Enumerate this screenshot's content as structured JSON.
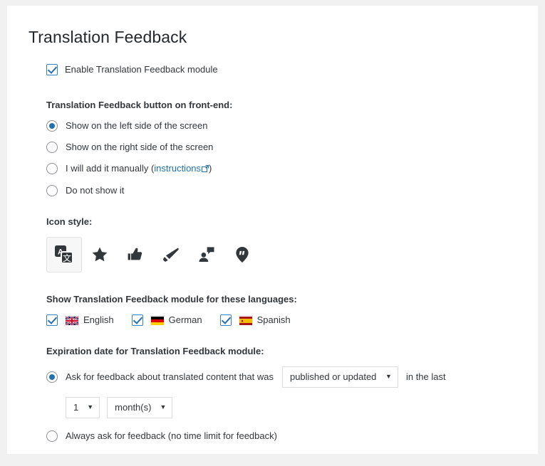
{
  "page": {
    "title": "Translation Feedback"
  },
  "enable_module": {
    "label": "Enable Translation Feedback module",
    "checked": true
  },
  "button_position": {
    "section_label": "Translation Feedback button on front-end:",
    "options": [
      {
        "label": "Show on the left side of the screen",
        "selected": true
      },
      {
        "label": "Show on the right side of the screen",
        "selected": false
      },
      {
        "label_before": "I will add it manually (",
        "link_text": "instructions",
        "label_after": ")",
        "selected": false
      },
      {
        "label": "Do not show it",
        "selected": false
      }
    ]
  },
  "icon_style": {
    "section_label": "Icon style:",
    "icons": [
      {
        "name": "translate-icon",
        "selected": true
      },
      {
        "name": "star-icon",
        "selected": false
      },
      {
        "name": "thumbs-up-icon",
        "selected": false
      },
      {
        "name": "megaphone-icon",
        "selected": false
      },
      {
        "name": "person-speech-bubble-icon",
        "selected": false
      },
      {
        "name": "quote-pin-icon",
        "selected": false
      }
    ]
  },
  "languages": {
    "section_label": "Show Translation Feedback module for these languages:",
    "items": [
      {
        "name": "English",
        "flag": "uk",
        "checked": true
      },
      {
        "name": "German",
        "flag": "de",
        "checked": true
      },
      {
        "name": "Spanish",
        "flag": "es",
        "checked": true
      }
    ]
  },
  "expiration": {
    "section_label": "Expiration date for Translation Feedback module:",
    "option_ask": {
      "selected": true,
      "text_before": "Ask for feedback about translated content that was",
      "state_select": {
        "value": "published or updated"
      },
      "text_after": "in the last",
      "amount_select": {
        "value": "1"
      },
      "unit_select": {
        "value": "month(s)"
      }
    },
    "option_always": {
      "selected": false,
      "label": "Always ask for feedback (no time limit for feedback)"
    }
  },
  "colors": {
    "accent": "#2271b1",
    "link": "#2271b1",
    "text": "#32373c",
    "title": "#23282d",
    "page_background": "#f1f1f1",
    "card_background": "#ffffff"
  }
}
